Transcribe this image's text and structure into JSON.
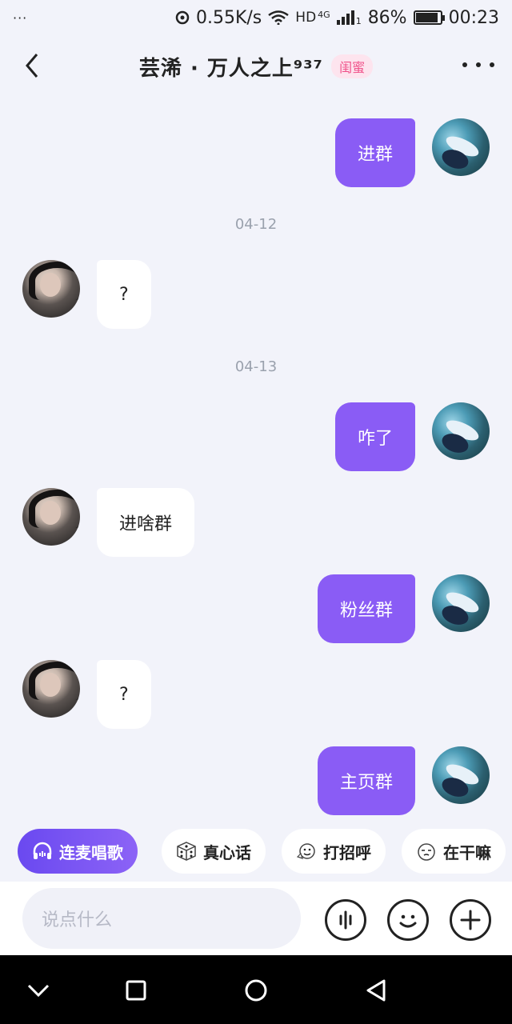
{
  "status_bar": {
    "dots": "···",
    "net_speed": "0.55K/s",
    "network": "HD",
    "network_sub": "4G",
    "sim": "1",
    "battery_percent": "86%",
    "battery_level": 0.86,
    "time": "00:23"
  },
  "header": {
    "title": "芸浠 · 万人之上⁹³⁷",
    "tag": "闺蜜"
  },
  "chat": {
    "messages": [
      {
        "from": "me",
        "text": "进群"
      },
      {
        "date": "04-12"
      },
      {
        "from": "other",
        "text": "?"
      },
      {
        "date": "04-13"
      },
      {
        "from": "me",
        "text": "咋了"
      },
      {
        "from": "other",
        "text": "进啥群"
      },
      {
        "from": "me",
        "text": "粉丝群"
      },
      {
        "from": "other",
        "text": "?"
      },
      {
        "from": "me",
        "text": "主页群"
      }
    ]
  },
  "quick_actions": [
    {
      "label": "连麦唱歌",
      "icon": "headphones-icon"
    },
    {
      "label": "真心话",
      "icon": "dice-icon"
    },
    {
      "label": "打招呼",
      "icon": "waving-emoji-icon"
    },
    {
      "label": "在干嘛",
      "icon": "sleepy-emoji-icon"
    }
  ],
  "input": {
    "placeholder": "说点什么"
  },
  "colors": {
    "accent": "#8a5cf5",
    "background": "#f2f3fa",
    "tag_pink": "#f0528a"
  }
}
